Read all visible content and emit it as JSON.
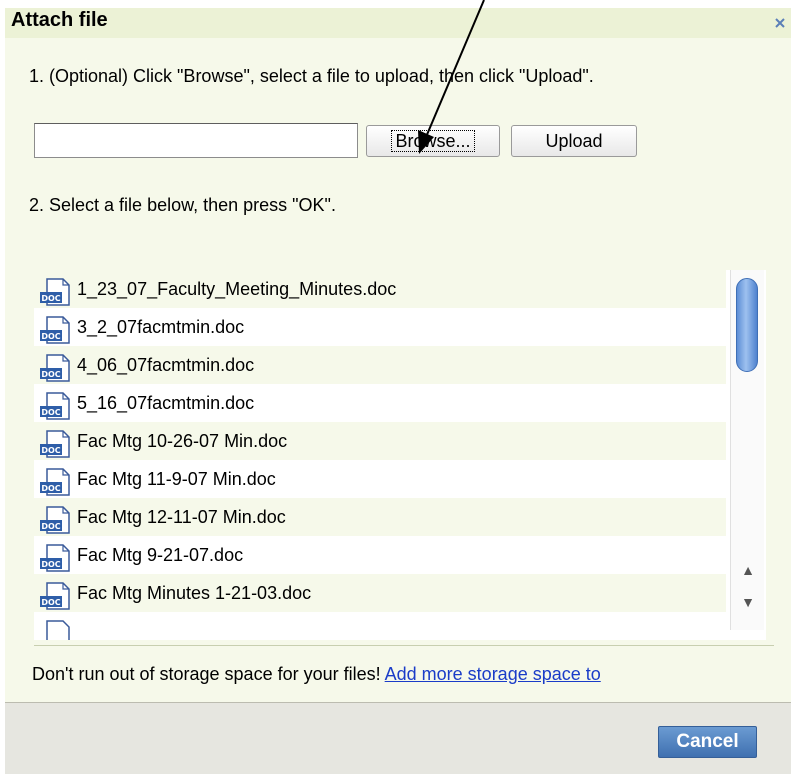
{
  "dialog": {
    "title": "Attach file",
    "close_glyph": "x"
  },
  "upload_step": {
    "instruction": "1. (Optional) Click \"Browse\", select a file to upload, then click \"Upload\".",
    "file_input_value": "",
    "browse_label": "Browse...",
    "upload_label": "Upload"
  },
  "select_step": {
    "instruction": "2. Select a file below, then press \"OK\"."
  },
  "files": [
    {
      "name": "1_23_07_Faculty_Meeting_Minutes.doc",
      "icon": "doc-file-icon"
    },
    {
      "name": "3_2_07facmtmin.doc",
      "icon": "doc-file-icon"
    },
    {
      "name": "4_06_07facmtmin.doc",
      "icon": "doc-file-icon"
    },
    {
      "name": "5_16_07facmtmin.doc",
      "icon": "doc-file-icon"
    },
    {
      "name": "Fac Mtg 10-26-07 Min.doc",
      "icon": "doc-file-icon"
    },
    {
      "name": "Fac Mtg 11-9-07 Min.doc",
      "icon": "doc-file-icon"
    },
    {
      "name": "Fac Mtg 12-11-07 Min.doc",
      "icon": "doc-file-icon"
    },
    {
      "name": "Fac Mtg 9-21-07.doc",
      "icon": "doc-file-icon"
    },
    {
      "name": "Fac Mtg Minutes 1-21-03.doc",
      "icon": "doc-file-icon"
    }
  ],
  "scrollbar": {
    "up_glyph": "▲",
    "down_glyph": "▼"
  },
  "promo": {
    "text": "Don't run out of storage space for your files! ",
    "link": "Add more storage space to"
  },
  "footer": {
    "cancel_label": "Cancel"
  },
  "colors": {
    "title_bar": "#ecf2d6",
    "body_bg": "#f6f9ea",
    "link": "#1a3cc8",
    "cancel_button": "#4f82c4",
    "scroll_thumb": "#5d8ed6"
  }
}
